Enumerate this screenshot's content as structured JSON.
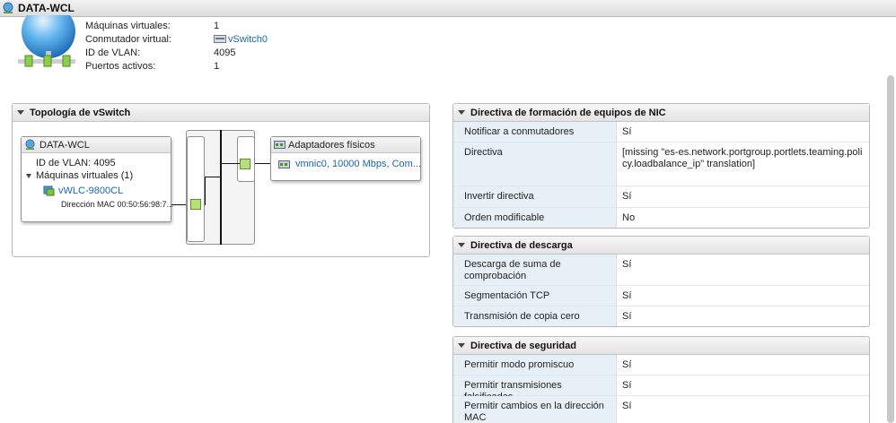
{
  "window": {
    "title": "DATA-WCL"
  },
  "summary": {
    "rows": [
      {
        "label": "Máquinas virtuales:",
        "value": "1"
      },
      {
        "label": "Conmutador virtual:",
        "value": "vSwitch0"
      },
      {
        "label": "ID de VLAN:",
        "value": "4095"
      },
      {
        "label": "Puertos activos:",
        "value": "1"
      }
    ]
  },
  "topology": {
    "title": "Topología de vSwitch",
    "portgroup": {
      "name": "DATA-WCL",
      "vlan": "ID de VLAN: 4095",
      "vms_label": "Máquinas virtuales (1)",
      "vm_name": "vWLC-9800CL",
      "mac": "Dirección MAC 00:50:56:98:7..."
    },
    "adapters": {
      "title": "Adaptadores físicos",
      "item": "vmnic0, 10000 Mbps, Com..."
    }
  },
  "nic_teaming": {
    "title": "Directiva de formación de equipos de NIC",
    "rows": [
      {
        "key": "Notificar a conmutadores",
        "value": "Sí"
      },
      {
        "key": "Directiva",
        "value": "[missing \"es-es.network.portgroup.portlets.teaming.policy.loadbalance_ip\" translation]"
      },
      {
        "key": "Invertir directiva",
        "value": "Sí"
      },
      {
        "key": "Orden modificable",
        "value": "No"
      }
    ]
  },
  "offload": {
    "title": "Directiva de descarga",
    "rows": [
      {
        "key": "Descarga de suma de comprobación",
        "value": "Sí"
      },
      {
        "key": "Segmentación TCP",
        "value": "Sí"
      },
      {
        "key": "Transmisión de copia cero",
        "value": "Sí"
      }
    ]
  },
  "security": {
    "title": "Directiva de seguridad",
    "rows": [
      {
        "key": "Permitir modo promiscuo",
        "value": "Sí"
      },
      {
        "key": "Permitir transmisiones falsificadas",
        "value": "Sí"
      },
      {
        "key": "Permitir cambios en la dirección MAC",
        "value": "Sí"
      }
    ]
  },
  "colors": {
    "link": "#1a66b8",
    "port": "#b7e07a",
    "key_bg": "#e8f0f7"
  }
}
